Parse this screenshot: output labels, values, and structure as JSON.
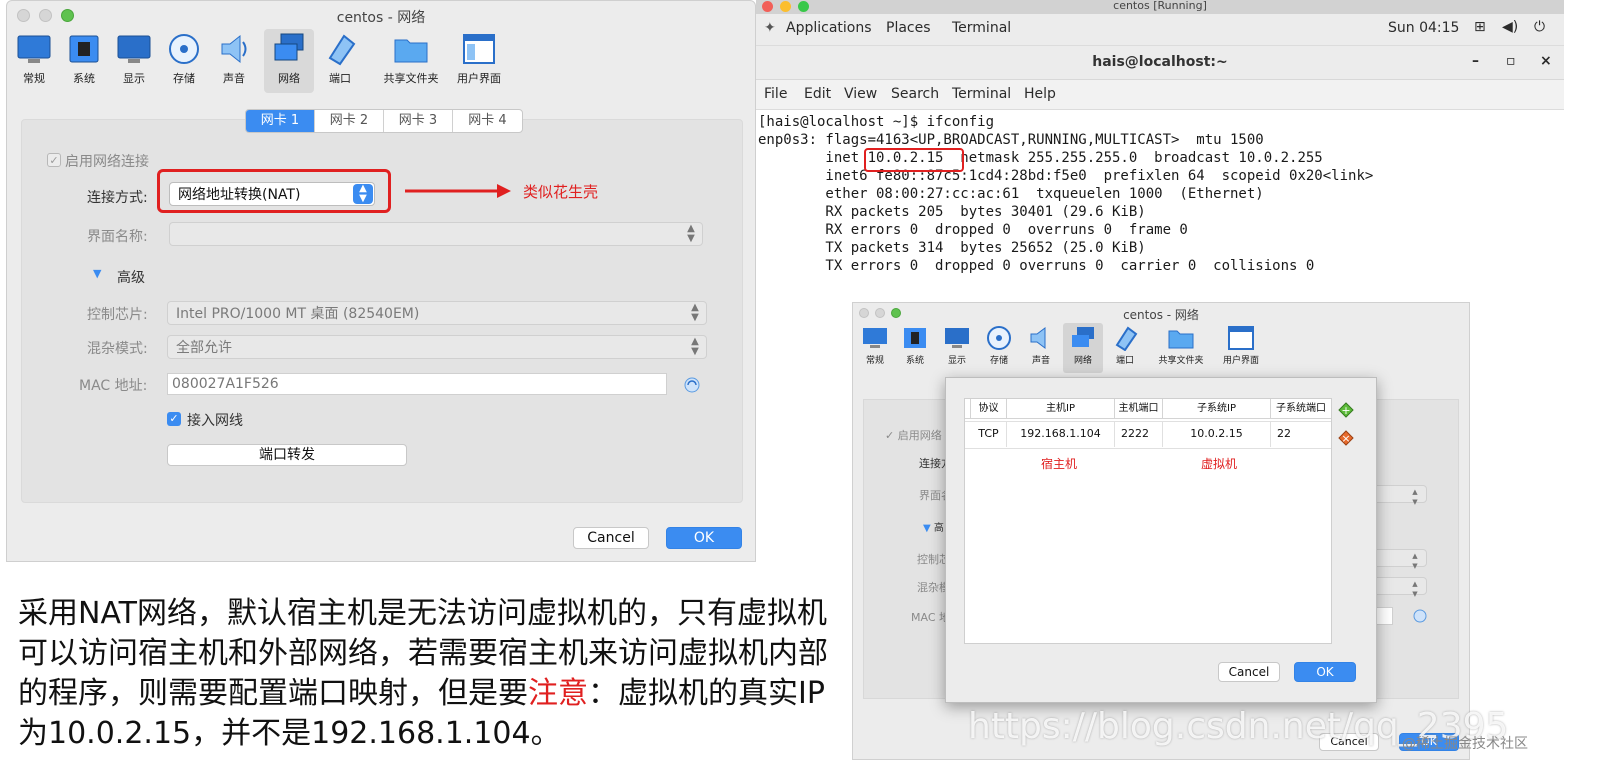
{
  "left_dialog": {
    "title": "centos - 网络",
    "toolbar": [
      "常规",
      "系统",
      "显示",
      "存储",
      "声音",
      "网络",
      "端口",
      "共享文件夹",
      "用户界面"
    ],
    "selected_toolbar": "网络",
    "tabs": [
      "网卡 1",
      "网卡 2",
      "网卡 3",
      "网卡 4"
    ],
    "active_tab": "网卡 1",
    "enable_label": "启用网络连接",
    "attach_label": "连接方式:",
    "attach_value": "网络地址转换(NAT)",
    "annotation": "类似花生壳",
    "name_label": "界面名称:",
    "advanced_label": "高级",
    "adapter_label": "控制芯片:",
    "adapter_value": "Intel PRO/1000 MT 桌面 (82540EM)",
    "promisc_label": "混杂模式:",
    "promisc_value": "全部允许",
    "mac_label": "MAC 地址:",
    "mac_value": "080027A1F526",
    "cable_label": "接入网线",
    "port_forward_label": "端口转发",
    "cancel": "Cancel",
    "ok": "OK"
  },
  "terminal": {
    "window_title": "centos [Running]",
    "gnome_menu": [
      "Applications",
      "Places",
      "Terminal"
    ],
    "clock": "Sun 04:15",
    "title": "hais@localhost:~",
    "window_controls": [
      "–",
      "▫",
      "×"
    ],
    "menu": [
      "File",
      "Edit",
      "View",
      "Search",
      "Terminal",
      "Help"
    ],
    "lines": [
      "[hais@localhost ~]$ ifconfig",
      "enp0s3: flags=4163<UP,BROADCAST,RUNNING,MULTICAST>  mtu 1500",
      "        inet 10.0.2.15  netmask 255.255.255.0  broadcast 10.0.2.255",
      "        inet6 fe80::87c5:1cd4:28bd:f5e0  prefixlen 64  scopeid 0x20<link>",
      "        ether 08:00:27:cc:ac:61  txqueuelen 1000  (Ethernet)",
      "        RX packets 205  bytes 30401 (29.6 KiB)",
      "        RX errors 0  dropped 0  overruns 0  frame 0",
      "        TX packets 314  bytes 25652 (25.0 KiB)",
      "        TX errors 0  dropped 0 overruns 0  carrier 0  collisions 0"
    ]
  },
  "right_dialog": {
    "title": "centos - 网络",
    "toolbar": [
      "常规",
      "系统",
      "显示",
      "存储",
      "声音",
      "网络",
      "端口",
      "共享文件夹",
      "用户界面"
    ],
    "bg_labels": [
      "启用网络",
      "连接方",
      "界面名",
      "高",
      "控制芯",
      "混杂模",
      "MAC 地"
    ],
    "table_headers": [
      "协议",
      "主机IP",
      "主机端口",
      "子系统IP",
      "子系统端口"
    ],
    "table_row": [
      "TCP",
      "192.168.1.104",
      "2222",
      "10.0.2.15",
      "22"
    ],
    "host_note": "宿主机",
    "guest_note": "虚拟机",
    "cancel": "Cancel",
    "ok": "OK",
    "bg_cancel": "Cancel",
    "bg_ok": "OK"
  },
  "caption": {
    "part1": "采用NAT网络，默认宿主机是无法访问虚拟机的，只有虚拟机可以访问宿主机和外部网络，若需要宿主机来访问虚拟机内部的程序，则需要配置端口映射，但是要",
    "highlight": "注意",
    "part2": "：虚拟机的真实IP为10.0.2.15，并不是192.168.1.104。"
  },
  "watermark": "https://blog.csdn.net/qq_2395",
  "watermark2": "@稀土掘金技术社区",
  "colors": {
    "accent": "#3b8cf1",
    "annotation": "#e02020"
  }
}
